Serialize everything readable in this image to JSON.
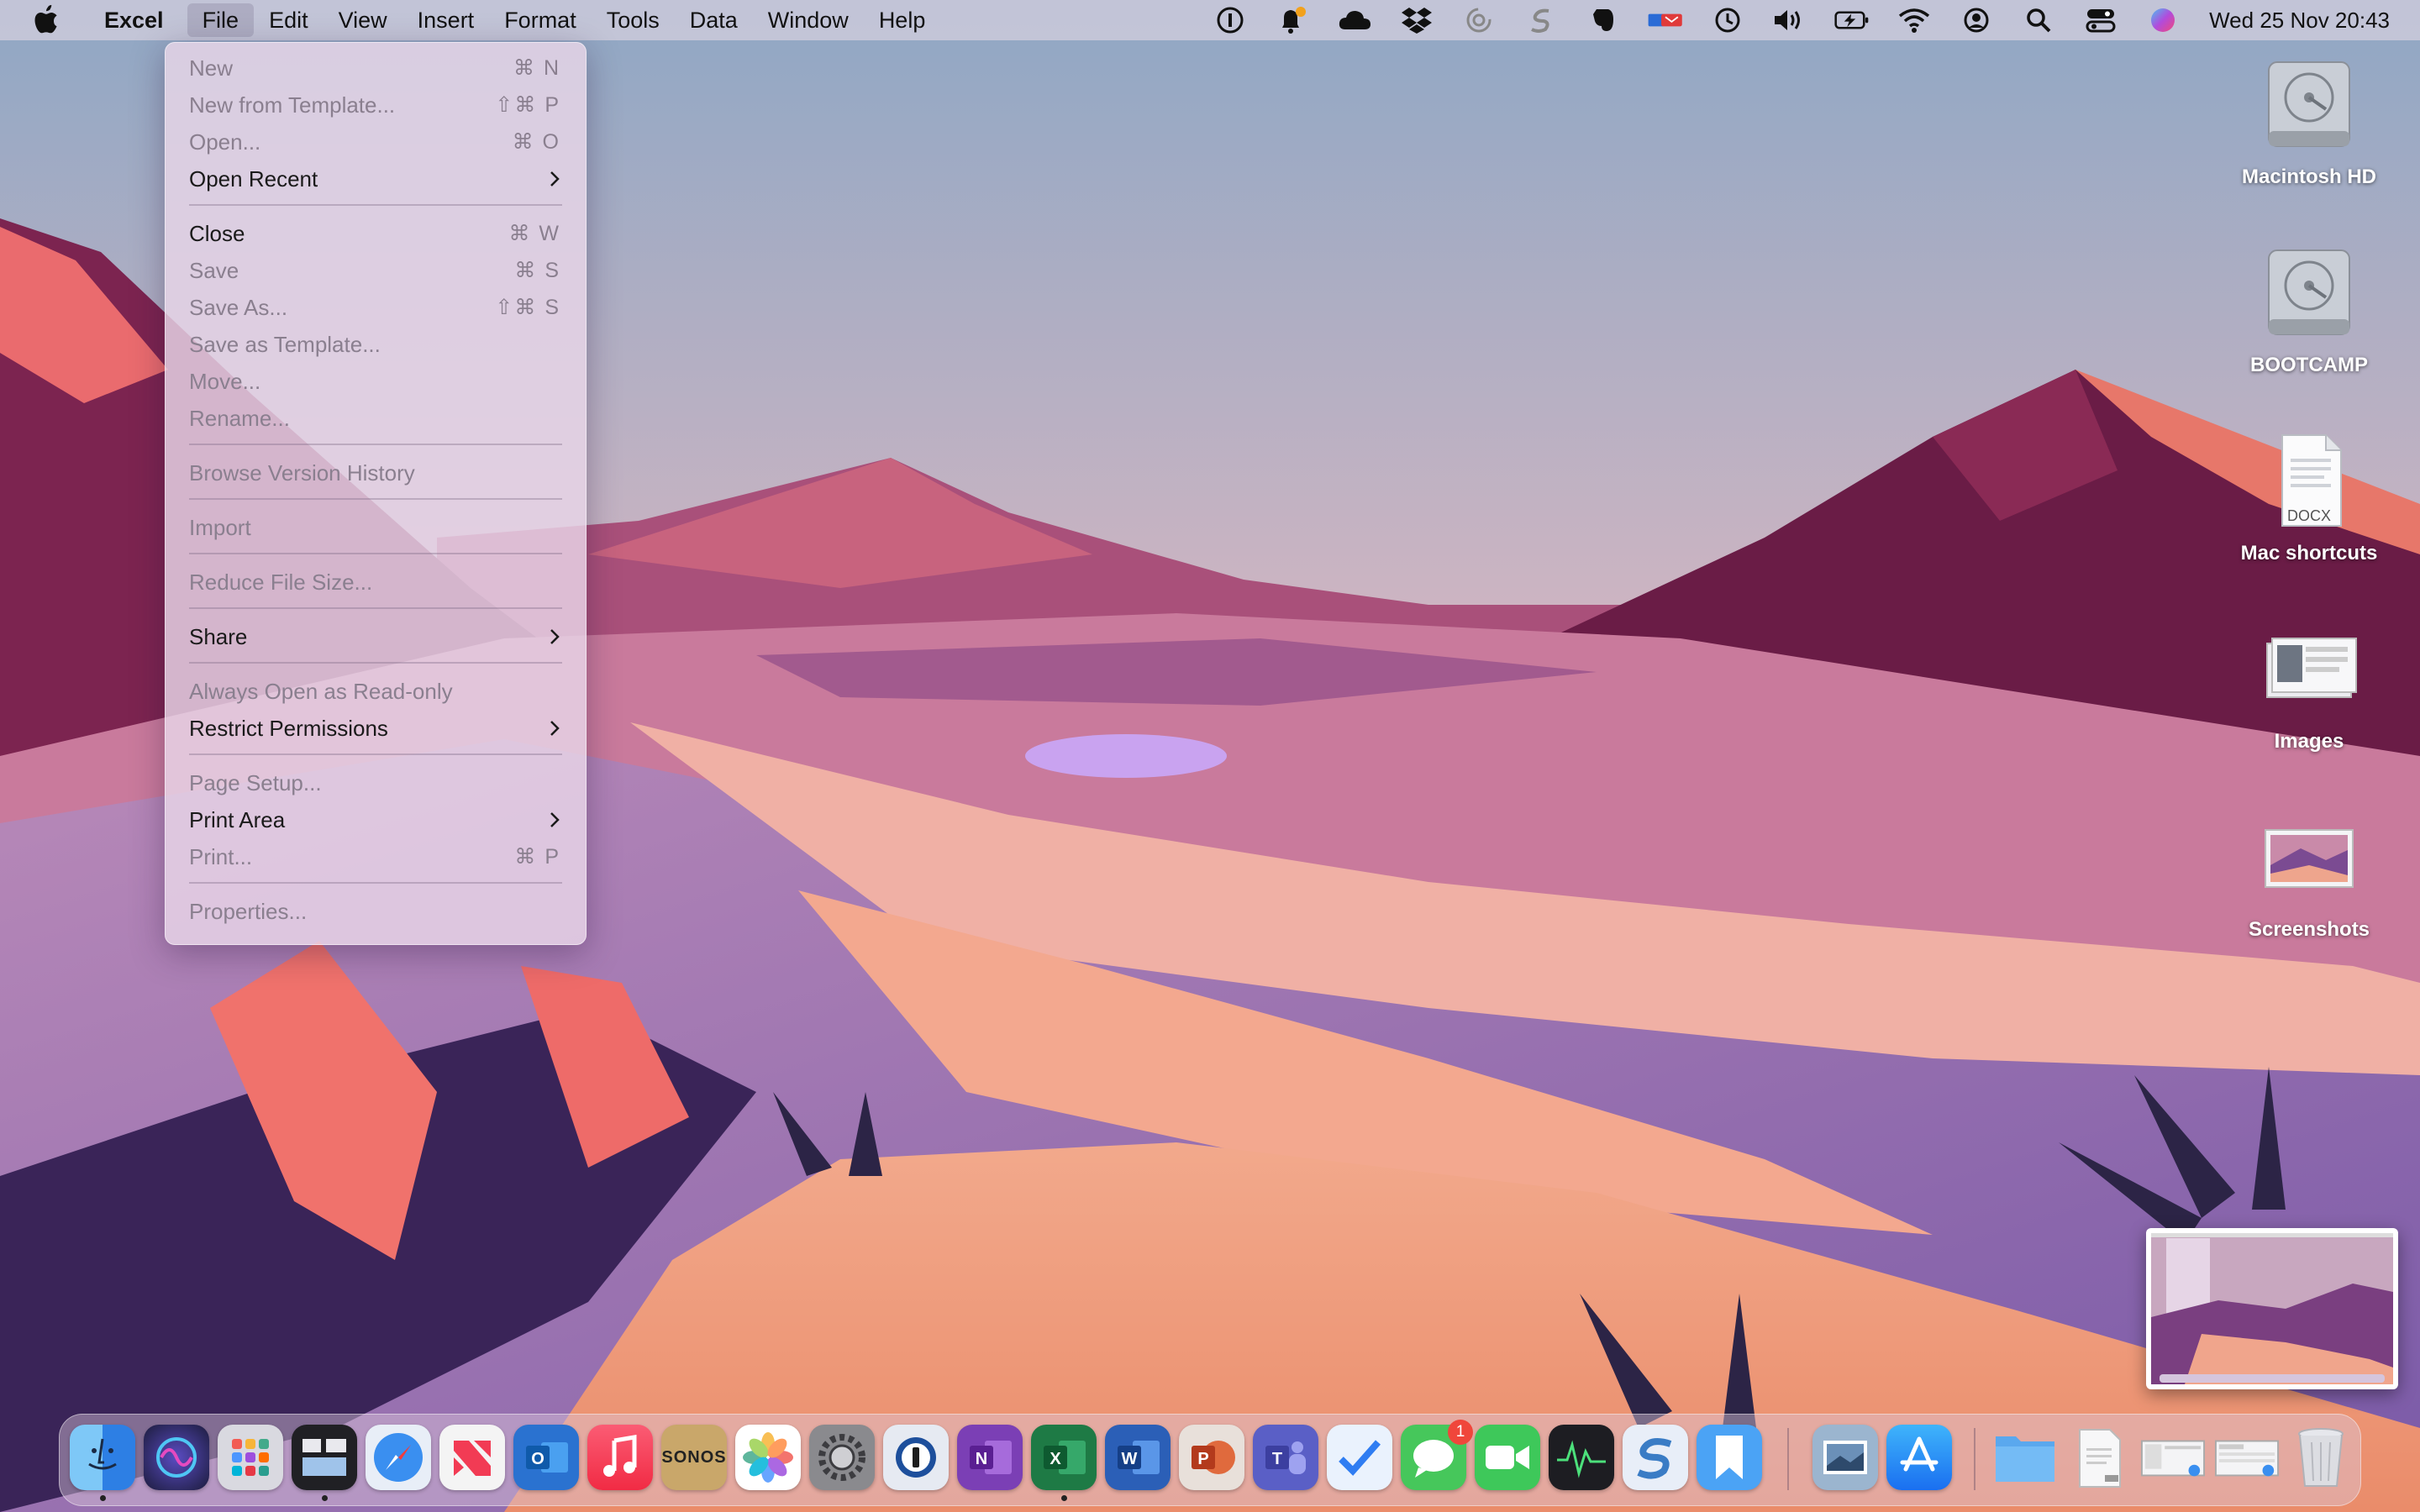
{
  "menubar": {
    "app_name": "Excel",
    "menus": [
      "File",
      "Edit",
      "View",
      "Insert",
      "Format",
      "Tools",
      "Data",
      "Window",
      "Help"
    ],
    "active_menu": "File",
    "clock": "Wed 25 Nov  20:43",
    "status_icons": [
      "1password-icon",
      "notification-bell-icon",
      "cloud-icon",
      "dropbox-icon",
      "sync-icon",
      "scrivener-icon",
      "evernote-icon",
      "mail-badge-icon",
      "time-machine-icon",
      "volume-icon",
      "battery-icon",
      "wifi-icon",
      "user-icon",
      "spotlight-search-icon",
      "control-center-icon",
      "siri-icon"
    ]
  },
  "file_menu": {
    "items": [
      {
        "label": "New",
        "shortcut": "⌘ N",
        "enabled": false
      },
      {
        "label": "New from Template...",
        "shortcut": "⇧⌘ P",
        "enabled": false
      },
      {
        "label": "Open...",
        "shortcut": "⌘ O",
        "enabled": false
      },
      {
        "label": "Open Recent",
        "submenu": true,
        "enabled": true
      },
      {
        "label": "Close",
        "shortcut": "⌘ W",
        "enabled": true
      },
      {
        "label": "Save",
        "shortcut": "⌘ S",
        "enabled": false
      },
      {
        "label": "Save As...",
        "shortcut": "⇧⌘ S",
        "enabled": false
      },
      {
        "label": "Save as Template...",
        "enabled": false
      },
      {
        "label": "Move...",
        "enabled": false
      },
      {
        "label": "Rename...",
        "enabled": false
      },
      {
        "label": "Browse Version History",
        "enabled": false
      },
      {
        "label": "Import",
        "enabled": false
      },
      {
        "label": "Reduce File Size...",
        "enabled": false
      },
      {
        "label": "Share",
        "submenu": true,
        "enabled": true
      },
      {
        "label": "Always Open as Read-only",
        "enabled": false
      },
      {
        "label": "Restrict Permissions",
        "submenu": true,
        "enabled": true
      },
      {
        "label": "Page Setup...",
        "enabled": false
      },
      {
        "label": "Print Area",
        "submenu": true,
        "enabled": true
      },
      {
        "label": "Print...",
        "shortcut": "⌘ P",
        "enabled": false
      },
      {
        "label": "Properties...",
        "enabled": false
      }
    ]
  },
  "desktop": {
    "icons": [
      {
        "label": "Macintosh HD",
        "type": "drive"
      },
      {
        "label": "BOOTCAMP",
        "type": "drive"
      },
      {
        "label": "Mac shortcuts",
        "type": "docx",
        "ext": "DOCX"
      },
      {
        "label": "Images",
        "type": "folder-stack"
      },
      {
        "label": "Screenshots",
        "type": "image-stack"
      }
    ]
  },
  "dock": {
    "messages_badge": "1",
    "sonos_label": "SONOS",
    "apps": [
      {
        "name": "finder",
        "color": "#3b8fe8"
      },
      {
        "name": "siri",
        "color": "#2b2b55"
      },
      {
        "name": "launchpad",
        "color": "#d9d9e0"
      },
      {
        "name": "mission-control",
        "color": "#222222"
      },
      {
        "name": "safari",
        "color": "#3a8ff0"
      },
      {
        "name": "news",
        "color": "#f2f2f2"
      },
      {
        "name": "outlook",
        "color": "#1d6fc7"
      },
      {
        "name": "music",
        "color": "#f43d55"
      },
      {
        "name": "sonos",
        "color": "#c9a76a"
      },
      {
        "name": "photos",
        "color": "#ffffff"
      },
      {
        "name": "system-preferences",
        "color": "#8a8a8e"
      },
      {
        "name": "1password",
        "color": "#e6eaf2"
      },
      {
        "name": "onenote",
        "color": "#7b3fb5"
      },
      {
        "name": "excel",
        "color": "#1e7a45"
      },
      {
        "name": "word",
        "color": "#2b5fb7"
      },
      {
        "name": "powerpoint",
        "color": "#c9482b"
      },
      {
        "name": "teams",
        "color": "#5a5fc6"
      },
      {
        "name": "things",
        "color": "#2f7df2"
      },
      {
        "name": "messages",
        "color": "#46c75b"
      },
      {
        "name": "facetime",
        "color": "#3ec85a"
      },
      {
        "name": "activity-monitor",
        "color": "#1d1d22"
      },
      {
        "name": "scrivener",
        "color": "#3a7cc5"
      },
      {
        "name": "readkit",
        "color": "#4ba3f5"
      },
      {
        "name": "preview",
        "color": "#9bb5cf"
      },
      {
        "name": "app-store",
        "color": "#1e88f0"
      },
      {
        "name": "downloads-folder",
        "color": "#4a9be6"
      },
      {
        "name": "pdf-stack",
        "color": "#e8e8ea"
      },
      {
        "name": "screenshot-stack-1",
        "color": "#f4f4f6"
      },
      {
        "name": "screenshot-stack-2",
        "color": "#f4f4f6"
      },
      {
        "name": "trash",
        "color": "#dcdde2"
      }
    ]
  },
  "colors": {
    "menu_text": "#1a1a1a",
    "menu_disabled": "#8a7f8f",
    "sky_top": "#8fa7c4",
    "sky_bottom": "#f1b9b0"
  }
}
